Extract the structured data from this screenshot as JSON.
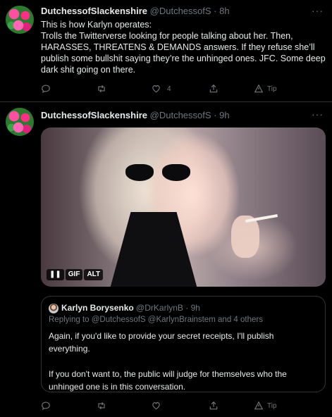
{
  "tweet1": {
    "author_name": "DutchessofSlackenshire",
    "handle": "@DutchessofS",
    "dot": "·",
    "time": "8h",
    "more": "···",
    "lines": [
      "This is how Karlyn operates:",
      "Trolls the Twitterverse looking for people talking about her.  Then,",
      "HARASSES, THREATENS & DEMANDS answers.  If they refuse she’ll",
      "publish some bullshit saying they’re the unhinged ones.  JFC.  Some deep",
      "dark shit going on there."
    ],
    "actions": {
      "like_count": "4",
      "tip_label": "Tip"
    }
  },
  "tweet2": {
    "author_name": "DutchessofSlackenshire",
    "handle": "@DutchessofS",
    "dot": "·",
    "time": "9h",
    "more": "···",
    "media": {
      "badges": {
        "pause": "❚❚",
        "gif": "GIF",
        "alt": "ALT"
      }
    },
    "quote": {
      "author_name": "Karlyn Borysenko",
      "handle": "@DrKarlynB",
      "dot": "·",
      "time": "9h",
      "replying_to": "Replying to @DutchessofS @KarlynBrainstem and 4 others",
      "paragraph1": [
        "Again, if you'd like to provide your secret receipts, I'll publish",
        "everything."
      ],
      "paragraph2": [
        "If you don't want to, the public will judge for themselves who the",
        "unhinged one is in this conversation."
      ]
    },
    "actions": {
      "tip_label": "Tip"
    }
  },
  "colors": {
    "background": "#000000",
    "text": "#e7e9ea",
    "secondary": "#71767b",
    "border": "#2f3336"
  }
}
